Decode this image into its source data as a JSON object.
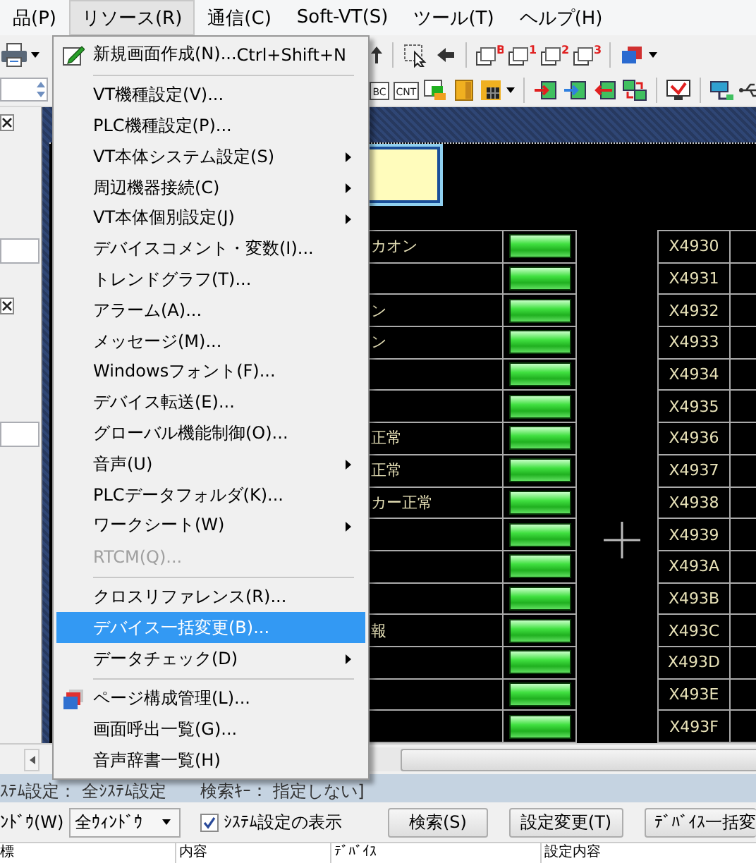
{
  "menubar": [
    {
      "label": "品(P)",
      "selected": false
    },
    {
      "label": "リソース(R)",
      "selected": true
    },
    {
      "label": "通信(C)",
      "selected": false
    },
    {
      "label": "Soft-VT(S)",
      "selected": false
    },
    {
      "label": "ツール(T)",
      "selected": false
    },
    {
      "label": "ヘルプ(H)",
      "selected": false
    }
  ],
  "toolbar": {
    "layer_badges": [
      "B",
      "1",
      "2",
      "3"
    ],
    "tag_labels": [
      "BC",
      "CNT"
    ]
  },
  "resource_menu": {
    "items": [
      {
        "kind": "item",
        "label": "新規画面作成(N)...",
        "shortcut": "Ctrl+Shift+N",
        "selected": false,
        "disabled": false
      },
      {
        "kind": "separator"
      },
      {
        "kind": "item",
        "label": "VT機種設定(V)...",
        "selected": false,
        "disabled": false
      },
      {
        "kind": "item",
        "label": "PLC機種設定(P)...",
        "selected": false,
        "disabled": false
      },
      {
        "kind": "submenu",
        "label": "VT本体システム設定(S)",
        "selected": false,
        "disabled": false
      },
      {
        "kind": "submenu",
        "label": "周辺機器接続(C)",
        "selected": false,
        "disabled": false
      },
      {
        "kind": "submenu",
        "label": "VT本体個別設定(J)",
        "selected": false,
        "disabled": false
      },
      {
        "kind": "item",
        "label": "デバイスコメント・変数(I)...",
        "selected": false,
        "disabled": false
      },
      {
        "kind": "item",
        "label": "トレンドグラフ(T)...",
        "selected": false,
        "disabled": false
      },
      {
        "kind": "item",
        "label": "アラーム(A)...",
        "selected": false,
        "disabled": false
      },
      {
        "kind": "item",
        "label": "メッセージ(M)...",
        "selected": false,
        "disabled": false
      },
      {
        "kind": "item",
        "label": "Windowsフォント(F)...",
        "selected": false,
        "disabled": false
      },
      {
        "kind": "item",
        "label": "デバイス転送(E)...",
        "selected": false,
        "disabled": false
      },
      {
        "kind": "item",
        "label": "グローバル機能制御(O)...",
        "selected": false,
        "disabled": false
      },
      {
        "kind": "submenu",
        "label": "音声(U)",
        "selected": false,
        "disabled": false
      },
      {
        "kind": "item",
        "label": "PLCデータフォルダ(K)...",
        "selected": false,
        "disabled": false
      },
      {
        "kind": "submenu",
        "label": "ワークシート(W)",
        "selected": false,
        "disabled": false
      },
      {
        "kind": "item",
        "label": "RTCM(Q)...",
        "selected": false,
        "disabled": true
      },
      {
        "kind": "separator"
      },
      {
        "kind": "item",
        "label": "クロスリファレンス(R)...",
        "selected": false,
        "disabled": false
      },
      {
        "kind": "item",
        "label": "デバイス一括変更(B)...",
        "selected": true,
        "disabled": false
      },
      {
        "kind": "submenu",
        "label": "データチェック(D)",
        "selected": false,
        "disabled": false
      },
      {
        "kind": "separator"
      },
      {
        "kind": "item",
        "label": "ページ構成管理(L)...",
        "selected": false,
        "disabled": false
      },
      {
        "kind": "item",
        "label": "画面呼出一覧(G)...",
        "selected": false,
        "disabled": false
      },
      {
        "kind": "item",
        "label": "音声辞書一覧(H)",
        "selected": false,
        "disabled": false
      }
    ]
  },
  "canvas": {
    "left_table": {
      "rows": [
        {
          "label": "カオン",
          "lamp_on": true
        },
        {
          "lamp_on": true
        },
        {
          "label": "ン",
          "lamp_on": true
        },
        {
          "label": "ン",
          "lamp_on": true
        },
        {
          "lamp_on": true
        },
        {
          "lamp_on": true
        },
        {
          "label": "正常",
          "lamp_on": true
        },
        {
          "label": "正常",
          "lamp_on": true
        },
        {
          "label": "カー正常",
          "lamp_on": true
        },
        {
          "lamp_on": true
        },
        {
          "lamp_on": true
        },
        {
          "lamp_on": true
        },
        {
          "label": "報",
          "lamp_on": true
        },
        {
          "lamp_on": true
        },
        {
          "lamp_on": true
        },
        {
          "lamp_on": true
        }
      ]
    },
    "right_table": {
      "rows": [
        "X4930",
        "X4931",
        "X4932",
        "X4933",
        "X4934",
        "X4935",
        "X4936",
        "X4937",
        "X4938",
        "X4939",
        "X493A",
        "X493B",
        "X493C",
        "X493D",
        "X493E",
        "X493F"
      ]
    }
  },
  "status_bar": {
    "system": "ｽﾃﾑ設定： 全ｼｽﾃﾑ設定",
    "search_key": "検索ｷｰ： 指定しない]"
  },
  "search_bar": {
    "window_label": "ﾝﾄﾞｳ(W)",
    "window_select": "全ｳｨﾝﾄﾞｳ",
    "show_system": {
      "label": "ｼｽﾃﾑ設定の表示",
      "checked": true
    },
    "buttons": [
      "検索(S)",
      "設定変更(T)",
      "ﾃﾞﾊﾞｲｽ一括変"
    ]
  },
  "list_header": [
    "標",
    "内容",
    "ﾃﾞﾊﾞｲｽ",
    "設定内容"
  ]
}
